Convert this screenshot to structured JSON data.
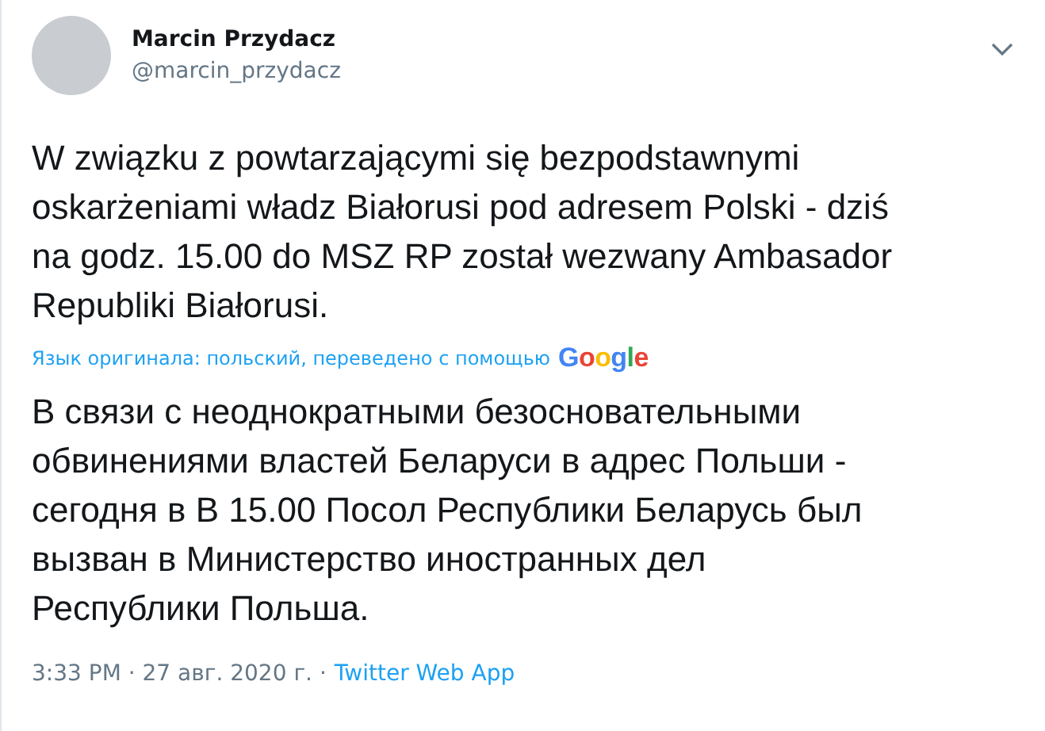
{
  "author": {
    "name": "Marcin Przydacz",
    "handle": "@marcin_przydacz"
  },
  "tweet_lines": [
    "W związku z powtarzającymi się bezpodstawnymi",
    "oskarżeniami władz Białorusi pod adresem Polski - dziś",
    "na godz. 15.00 do MSZ RP został wezwany Ambasador",
    "Republiki Białorusi."
  ],
  "translation_note": "Язык оригинала: польский, переведено с помощью",
  "translation_logo": "Google",
  "translation_lines": [
    "В связи с неоднократными безосновательными",
    "обвинениями властей Беларуси в адрес Польши -",
    "сегодня в В 15.00 Посол Республики Беларусь был",
    "вызван в Министерство иностранных дел",
    "Республики Польша."
  ],
  "timestamp": "3:33 PM · 27 авг. 2020 г. ·",
  "source": "Twitter Web App"
}
